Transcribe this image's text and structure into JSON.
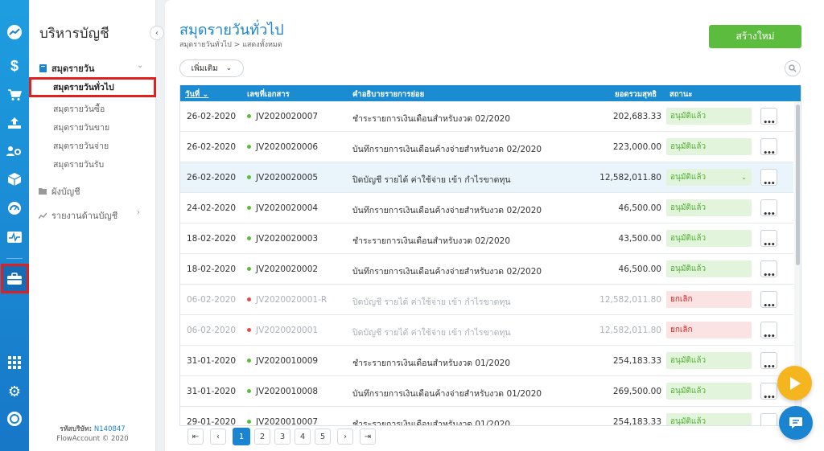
{
  "rail": {
    "icons": [
      "trend-icon",
      "dollar-icon",
      "cart-icon",
      "upload-icon",
      "people-coins-icon",
      "box-icon",
      "gauge-icon",
      "pulse-icon",
      "briefcase-icon",
      "grid-icon",
      "gear-icon",
      "logo-icon"
    ]
  },
  "sidebar": {
    "title": "บริหารบัญชี",
    "journal_group": "สมุดรายวัน",
    "journal_items": [
      "สมุดรายวันทั่วไป",
      "สมุดรายวันซื้อ",
      "สมุดรายวันขาย",
      "สมุดรายวันจ่าย",
      "สมุดรายวันรับ"
    ],
    "chart_of_accounts": "ผังบัญชี",
    "reports": "รายงานด้านบัญชี",
    "company_label": "รหัสบริษัท:",
    "company_code": "N140847",
    "copyright": "FlowAccount © 2020"
  },
  "header": {
    "title": "สมุดรายวันทั่วไป",
    "breadcrumb": "สมุดรายวันทั่วไป > แสดงทั้งหมด",
    "create_label": "สร้างใหม่",
    "more_filter_label": "เพิ่มเติม"
  },
  "table": {
    "columns": {
      "date": "วันที่",
      "doc_no": "เลขที่เอกสาร",
      "desc": "คำอธิบายรายการย่อย",
      "net": "ยอดรวมสุทธิ",
      "status": "สถานะ"
    },
    "rows": [
      {
        "date": "26-02-2020",
        "doc": "JV2020020007",
        "desc": "ชำระรายการเงินเดือนสำหรับงวด 02/2020",
        "net": "202,683.33",
        "status": "อนุมัติแล้ว"
      },
      {
        "date": "26-02-2020",
        "doc": "JV2020020006",
        "desc": "บันทึกรายการเงินเดือนค้างจ่ายสำหรับงวด 02/2020",
        "net": "223,000.00",
        "status": "อนุมัติแล้ว"
      },
      {
        "date": "26-02-2020",
        "doc": "JV2020020005",
        "desc": "ปิดบัญชี รายได้ ค่าใช้จ่าย เข้า กำไรขาดทุน",
        "net": "12,582,011.80",
        "status": "อนุมัติแล้ว"
      },
      {
        "date": "24-02-2020",
        "doc": "JV2020020004",
        "desc": "บันทึกรายการเงินเดือนค้างจ่ายสำหรับงวด 02/2020",
        "net": "46,500.00",
        "status": "อนุมัติแล้ว"
      },
      {
        "date": "18-02-2020",
        "doc": "JV2020020003",
        "desc": "ชำระรายการเงินเดือนสำหรับงวด 02/2020",
        "net": "43,500.00",
        "status": "อนุมัติแล้ว"
      },
      {
        "date": "18-02-2020",
        "doc": "JV2020020002",
        "desc": "บันทึกรายการเงินเดือนค้างจ่ายสำหรับงวด 02/2020",
        "net": "46,500.00",
        "status": "อนุมัติแล้ว"
      },
      {
        "date": "06-02-2020",
        "doc": "JV2020020001-R",
        "desc": "ปิดบัญชี รายได้ ค่าใช้จ่าย เข้า กำไรขาดทุน",
        "net": "12,582,011.80",
        "status": "ยกเลิก"
      },
      {
        "date": "06-02-2020",
        "doc": "JV2020020001",
        "desc": "ปิดบัญชี รายได้ ค่าใช้จ่าย เข้า กำไรขาดทุน",
        "net": "12,582,011.80",
        "status": "ยกเลิก"
      },
      {
        "date": "31-01-2020",
        "doc": "JV2020010009",
        "desc": "ชำระรายการเงินเดือนสำหรับงวด 01/2020",
        "net": "254,183.33",
        "status": "อนุมัติแล้ว"
      },
      {
        "date": "31-01-2020",
        "doc": "JV2020010008",
        "desc": "บันทึกรายการเงินเดือนค้างจ่ายสำหรับงวด 01/2020",
        "net": "269,500.00",
        "status": "อนุมัติแล้ว"
      },
      {
        "date": "29-01-2020",
        "doc": "JV2020010007",
        "desc": "ชำระรายการเงินเดือนสำหรับงวด 01/2020",
        "net": "254,183.33",
        "status": "อนุมัติแล้ว"
      }
    ]
  },
  "pager": {
    "pages": [
      "1",
      "2",
      "3",
      "4",
      "5"
    ],
    "current": "1"
  },
  "colors": {
    "accent": "#1b84d1",
    "approved": "#4caf2e",
    "cancelled": "#e0201e",
    "create": "#5cbc3d",
    "highlight": "#e0201e"
  }
}
